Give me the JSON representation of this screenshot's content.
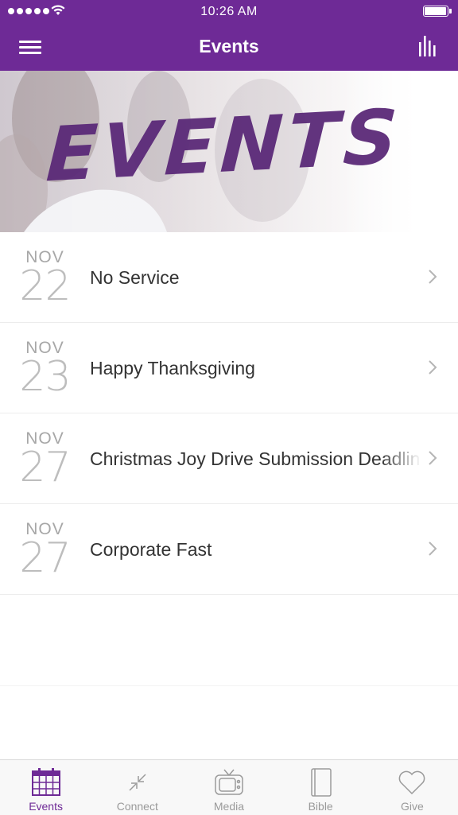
{
  "status_bar": {
    "time": "10:26 AM"
  },
  "nav": {
    "title": "Events",
    "menu_icon": "hamburger-menu-icon",
    "right_icon": "bar-chart-icon"
  },
  "banner": {
    "title": "EVENTS"
  },
  "events": [
    {
      "month": "NOV",
      "day": "22",
      "title": "No Service"
    },
    {
      "month": "NOV",
      "day": "23",
      "title": "Happy Thanksgiving"
    },
    {
      "month": "NOV",
      "day": "27",
      "title": "Christmas Joy Drive Submission Deadline"
    },
    {
      "month": "NOV",
      "day": "27",
      "title": "Corporate Fast"
    }
  ],
  "tabs": [
    {
      "label": "Events",
      "icon": "calendar-icon",
      "active": true
    },
    {
      "label": "Connect",
      "icon": "connect-arrows-icon",
      "active": false
    },
    {
      "label": "Media",
      "icon": "tv-icon",
      "active": false
    },
    {
      "label": "Bible",
      "icon": "book-icon",
      "active": false
    },
    {
      "label": "Give",
      "icon": "heart-icon",
      "active": false
    }
  ],
  "colors": {
    "brand": "#6e2a96",
    "banner_text": "#5b2a78",
    "inactive_tab": "#9a9a9a"
  }
}
